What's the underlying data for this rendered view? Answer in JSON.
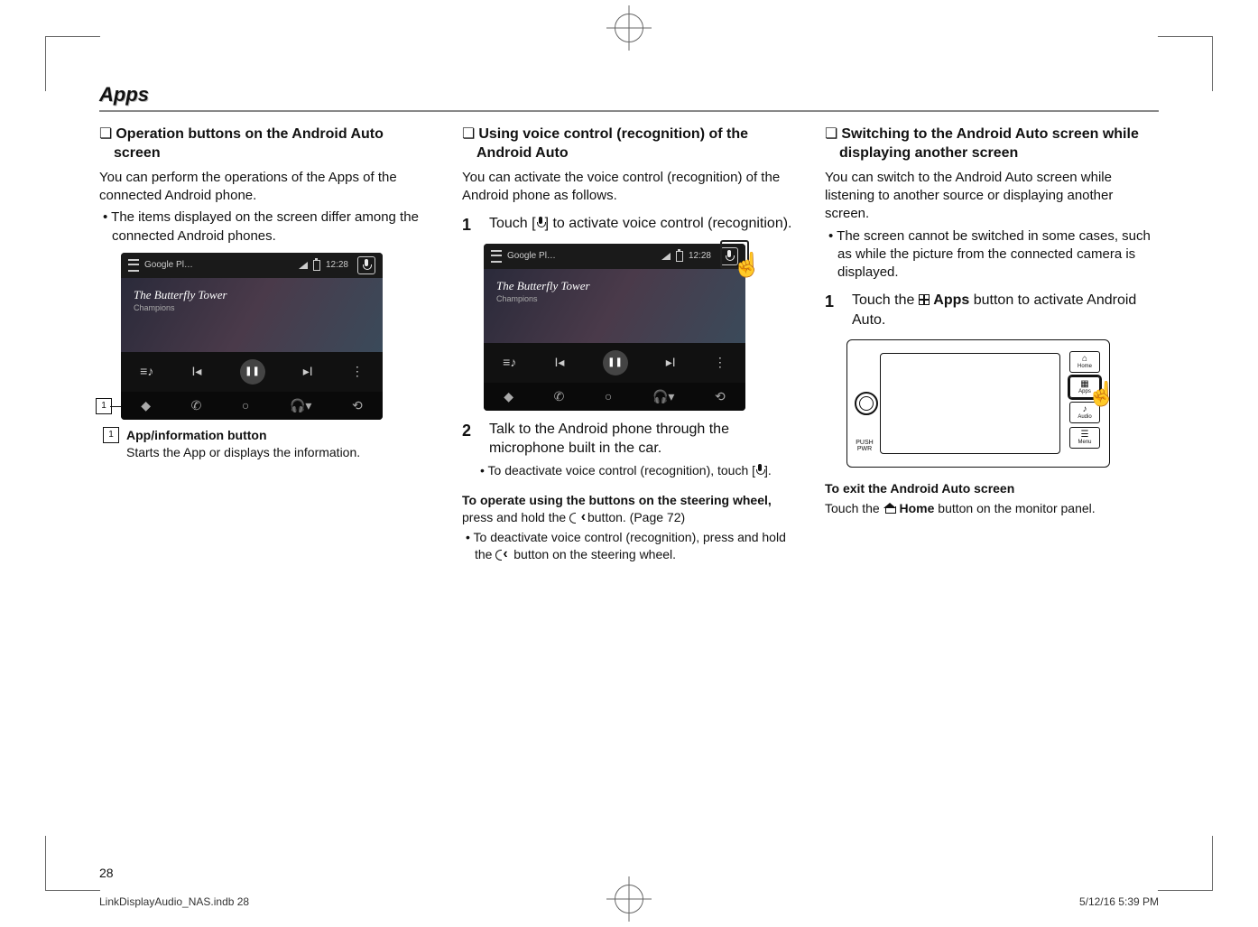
{
  "page": {
    "section_title": "Apps",
    "number": "28",
    "footer_left": "LinkDisplayAudio_NAS.indb   28",
    "footer_right": "5/12/16   5:39 PM"
  },
  "col1": {
    "heading": "Operation buttons on the Android Auto screen",
    "p1": "You can perform the operations of the Apps of the connected Android phone.",
    "bullet1": "The items displayed on the screen differ among the connected Android phones.",
    "callout_num": "1",
    "legend_num": "1",
    "legend_title": "App/information button",
    "legend_desc": "Starts the App or displays the information."
  },
  "col2": {
    "heading": "Using voice control (recognition) of the Android Auto",
    "p1": "You can activate the voice control (recognition) of the Android phone as follows.",
    "step1_num": "1",
    "step1_a": "Touch [",
    "step1_b": "] to activate voice control (recognition).",
    "step2_num": "2",
    "step2_text": "Talk to the Android phone through the microphone built in the car.",
    "step2_sub_a": "To deactivate voice control (recognition), touch [",
    "step2_sub_b": "].",
    "steering_a": "To operate using the buttons on the steering wheel,",
    "steering_b": " press and hold the ",
    "steering_c": " button. (Page 72)",
    "steering_bullet_a": "To deactivate voice control (recognition), press and hold the ",
    "steering_bullet_b": " button on the steering wheel."
  },
  "col3": {
    "heading": "Switching to the Android Auto screen while displaying another screen",
    "p1": "You can switch to the Android Auto screen while listening to another source or displaying another screen.",
    "bullet1": "The screen cannot be switched in some cases, such as while the picture from the connected camera is displayed.",
    "step1_num": "1",
    "step1_a": "Touch the ",
    "step1_apps": "Apps",
    "step1_b": " button to activate Android Auto.",
    "exit_title": "To exit the Android Auto screen",
    "exit_a": "Touch the ",
    "exit_home": "Home",
    "exit_b": " button on the monitor panel."
  },
  "screenshot": {
    "provider": "Google Pl…",
    "time": "12:28",
    "song_title": "The Butterfly Tower",
    "song_sub": "Champions"
  },
  "panel": {
    "knob_label": "PUSH PWR",
    "btn_home": "Home",
    "btn_apps": "Apps",
    "btn_audio": "Audio",
    "btn_menu": "Menu"
  }
}
